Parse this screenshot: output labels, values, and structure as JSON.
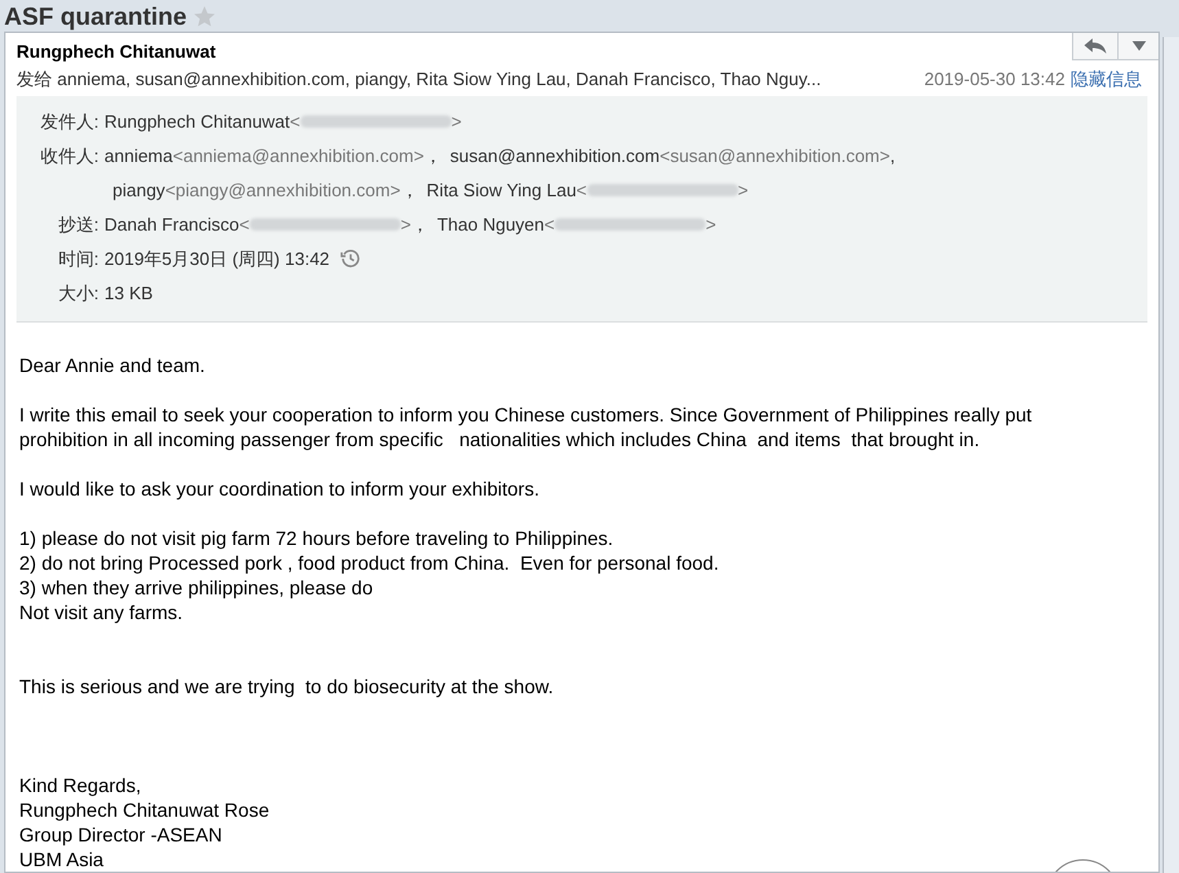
{
  "subject": {
    "title": "ASF quarantine",
    "starred": false
  },
  "header": {
    "sender": "Rungphech Chitanuwat",
    "to_prefix": "发给",
    "to_summary": "anniema, susan@annexhibition.com, piangy, Rita Siow Ying Lau, Danah Francisco, Thao Nguy...",
    "date": "2019-05-30 13:42",
    "toggle_link": "隐藏信息"
  },
  "details": [
    {
      "label": "发件人:",
      "entries": [
        {
          "name": "Rungphech Chitanuwat",
          "open": "<",
          "redacted": true,
          "close": ">"
        }
      ]
    },
    {
      "label": "收件人:",
      "entries": [
        {
          "name": "anniema",
          "address": "<anniema@annexhibition.com>",
          "sep": "，"
        },
        {
          "name": "susan@annexhibition.com",
          "address": "<susan@annexhibition.com>",
          "sep": ","
        },
        {
          "name": "piangy",
          "address": "<piangy@annexhibition.com>",
          "sep": "，",
          "break_before": true
        },
        {
          "name": "Rita Siow Ying Lau",
          "open": "<",
          "redacted": true,
          "close": ">"
        }
      ]
    },
    {
      "label": "抄送:",
      "entries": [
        {
          "name": "Danah Francisco",
          "open": "<",
          "redacted": true,
          "close": ">",
          "sep": "，"
        },
        {
          "name": "Thao Nguyen",
          "open": "<",
          "redacted": true,
          "close": ">"
        }
      ]
    },
    {
      "label": "时间:",
      "entries": [
        {
          "name": "2019年5月30日 (周四) 13:42",
          "history_icon": true
        }
      ]
    },
    {
      "label": "大小:",
      "entries": [
        {
          "name": "13 KB"
        }
      ]
    }
  ],
  "body": [
    {
      "kind": "greeting",
      "lines": [
        "Dear Annie and team."
      ]
    },
    {
      "kind": "paragraph",
      "lines": [
        "I write this email to seek your cooperation to inform you Chinese customers. Since Government of Philippines really put",
        "prohibition in all incoming passenger from specific   nationalities which includes China  and items  that brought in."
      ]
    },
    {
      "kind": "paragraph",
      "lines": [
        "I would like to ask your coordination to inform your exhibitors."
      ]
    },
    {
      "kind": "paragraph",
      "lines": [
        "1) please do not visit pig farm 72 hours before traveling to Philippines.",
        "2) do not bring Processed pork , food product from China.  Even for personal food.",
        "3) when they arrive philippines, please do",
        "Not visit any farms."
      ]
    },
    {
      "kind": "closing_remark",
      "lines": [
        "This is serious and we are trying  to do biosecurity at the show."
      ]
    },
    {
      "kind": "signature",
      "lines": [
        "Kind Regards,",
        "Rungphech Chitanuwat Rose",
        "Group Director -ASEAN",
        "UBM Asia"
      ]
    }
  ]
}
